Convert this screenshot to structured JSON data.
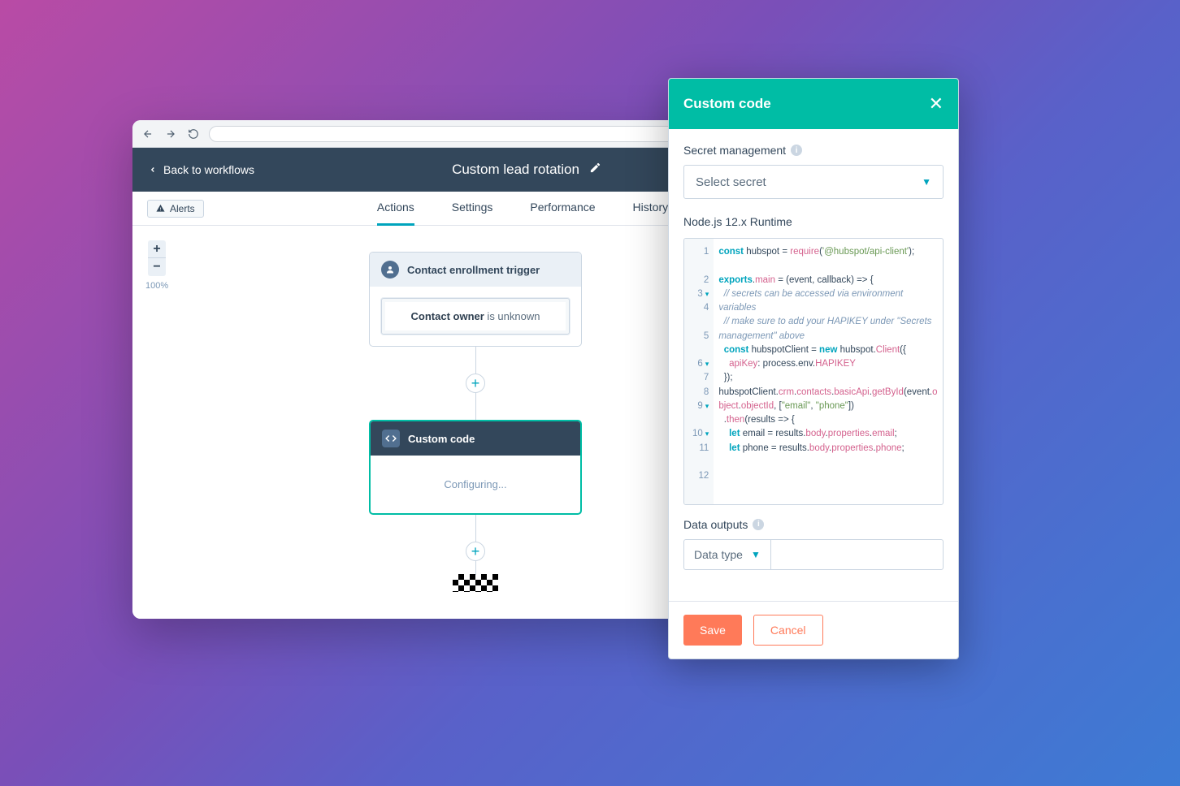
{
  "header": {
    "back_label": "Back to workflows",
    "title": "Custom lead rotation"
  },
  "tabs": {
    "actions": "Actions",
    "settings": "Settings",
    "performance": "Performance",
    "history": "History"
  },
  "alerts_label": "Alerts",
  "zoom_level": "100%",
  "workflow": {
    "trigger_title": "Contact enrollment trigger",
    "trigger_field": "Contact owner",
    "trigger_cond": " is unknown",
    "custom_title": "Custom code",
    "custom_body": "Configuring..."
  },
  "panel": {
    "title": "Custom code",
    "secret_label": "Secret management",
    "secret_placeholder": "Select secret",
    "runtime": "Node.js 12.x Runtime",
    "data_outputs_label": "Data outputs",
    "data_type_label": "Data type",
    "save": "Save",
    "cancel": "Cancel"
  },
  "code_lines": [
    "1",
    "2",
    "3",
    "4",
    "5",
    "6",
    "7",
    "8",
    "9",
    "10",
    "11",
    "12"
  ]
}
